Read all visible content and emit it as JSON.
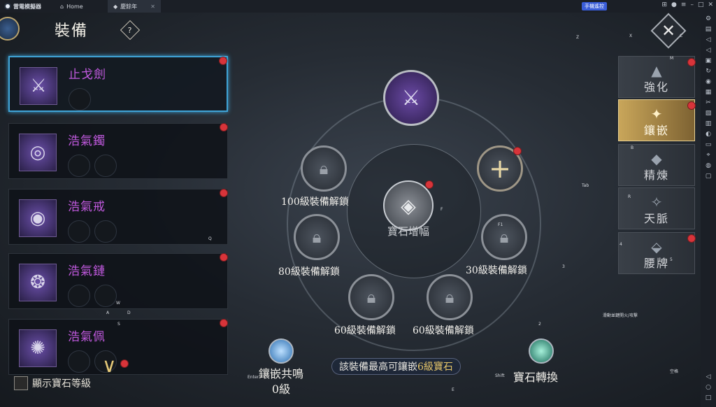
{
  "emulator": {
    "app_name": "雷電模擬器",
    "tabs": [
      {
        "label": "Home"
      },
      {
        "label": "慶餘年"
      }
    ],
    "remote_label": "手機遙控"
  },
  "game": {
    "title": "裝備",
    "help_label": "?",
    "items": [
      {
        "name": "止戈劍",
        "icon": "sword-icon",
        "slots": 1
      },
      {
        "name": "浩氣鐲",
        "icon": "bracelet-icon",
        "slots": 2
      },
      {
        "name": "浩氣戒",
        "icon": "ring-icon",
        "slots": 2
      },
      {
        "name": "浩氣鏈",
        "icon": "necklace-icon",
        "slots": 2
      },
      {
        "name": "浩氣佩",
        "icon": "pendant-icon",
        "slots": 2
      }
    ],
    "show_gem_level_label": "顯示寶石等級",
    "center": {
      "gem_boost_label": "寶石增幅",
      "unlock_100": "100級裝備解鎖",
      "unlock_80": "80級裝備解鎖",
      "unlock_30": "30級裝備解鎖",
      "unlock_60a": "60級裝備解鎖",
      "unlock_60b": "60級裝備解鎖"
    },
    "resonance_label": "鑲嵌共鳴",
    "resonance_level": "0級",
    "convert_label": "寶石轉換",
    "note_prefix": "該裝備最高可鑲嵌",
    "note_highlight": "6級寶石",
    "right_tabs": [
      {
        "label": "強化",
        "icon": "anvil-icon"
      },
      {
        "label": "鑲嵌",
        "icon": "gem-socket-icon"
      },
      {
        "label": "精煉",
        "icon": "refine-icon"
      },
      {
        "label": "天脈",
        "icon": "meridian-icon"
      },
      {
        "label": "腰牌",
        "icon": "token-icon"
      }
    ],
    "keys": {
      "z": "Z",
      "x": "X",
      "c": "C",
      "m": "M",
      "b": "B",
      "tab": "Tab",
      "r": "R",
      "f": "F",
      "f1": "F1",
      "q": "Q",
      "w": "W",
      "a": "A",
      "s": "S",
      "d": "D",
      "k3": "3",
      "k4": "4",
      "k5": "5",
      "k2": "2",
      "enter": "Enter",
      "shift": "Shift",
      "e": "E",
      "space": "空格",
      "hint": "滑動並鍵開火/攻擊"
    }
  }
}
